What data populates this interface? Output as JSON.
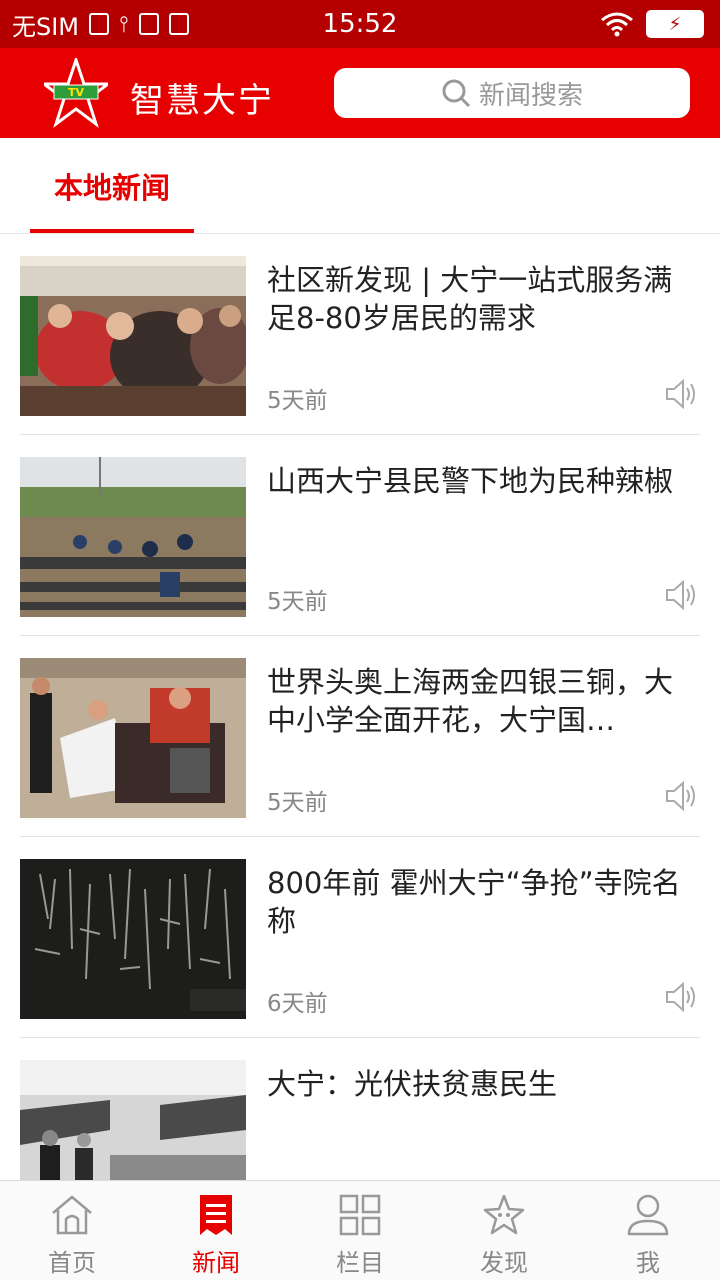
{
  "status": {
    "carrier": "无SIM",
    "time": "15:52",
    "battery": "⚡"
  },
  "header": {
    "app_title": "智慧大宁",
    "logo_text": "TV",
    "search_placeholder": "新闻搜索"
  },
  "tabs": [
    {
      "label": "本地新闻",
      "active": true
    }
  ],
  "news": [
    {
      "title": "社区新发现 | 大宁一站式服务满足8-80岁居民的需求",
      "time": "5天前",
      "thumb": "crowd-photo"
    },
    {
      "title": "山西大宁县民警下地为民种辣椒",
      "time": "5天前",
      "thumb": "field-photo"
    },
    {
      "title": "世界头奥上海两金四银三铜，大中小学全面开花，大宁国…",
      "time": "5天前",
      "thumb": "costume-photo"
    },
    {
      "title": "800年前 霍州大宁“争抢”寺院名称",
      "time": "6天前",
      "thumb": "calligraphy-photo"
    },
    {
      "title": "大宁：光伏扶贫惠民生",
      "time": "",
      "thumb": "solar-photo"
    }
  ],
  "bottom_nav": [
    {
      "label": "首页",
      "icon": "home-icon",
      "active": false
    },
    {
      "label": "新闻",
      "icon": "news-icon",
      "active": true
    },
    {
      "label": "栏目",
      "icon": "grid-icon",
      "active": false
    },
    {
      "label": "发现",
      "icon": "star-icon",
      "active": false
    },
    {
      "label": "我",
      "icon": "user-icon",
      "active": false
    }
  ],
  "colors": {
    "brand_red": "#e60000",
    "status_bar": "#b40000"
  }
}
